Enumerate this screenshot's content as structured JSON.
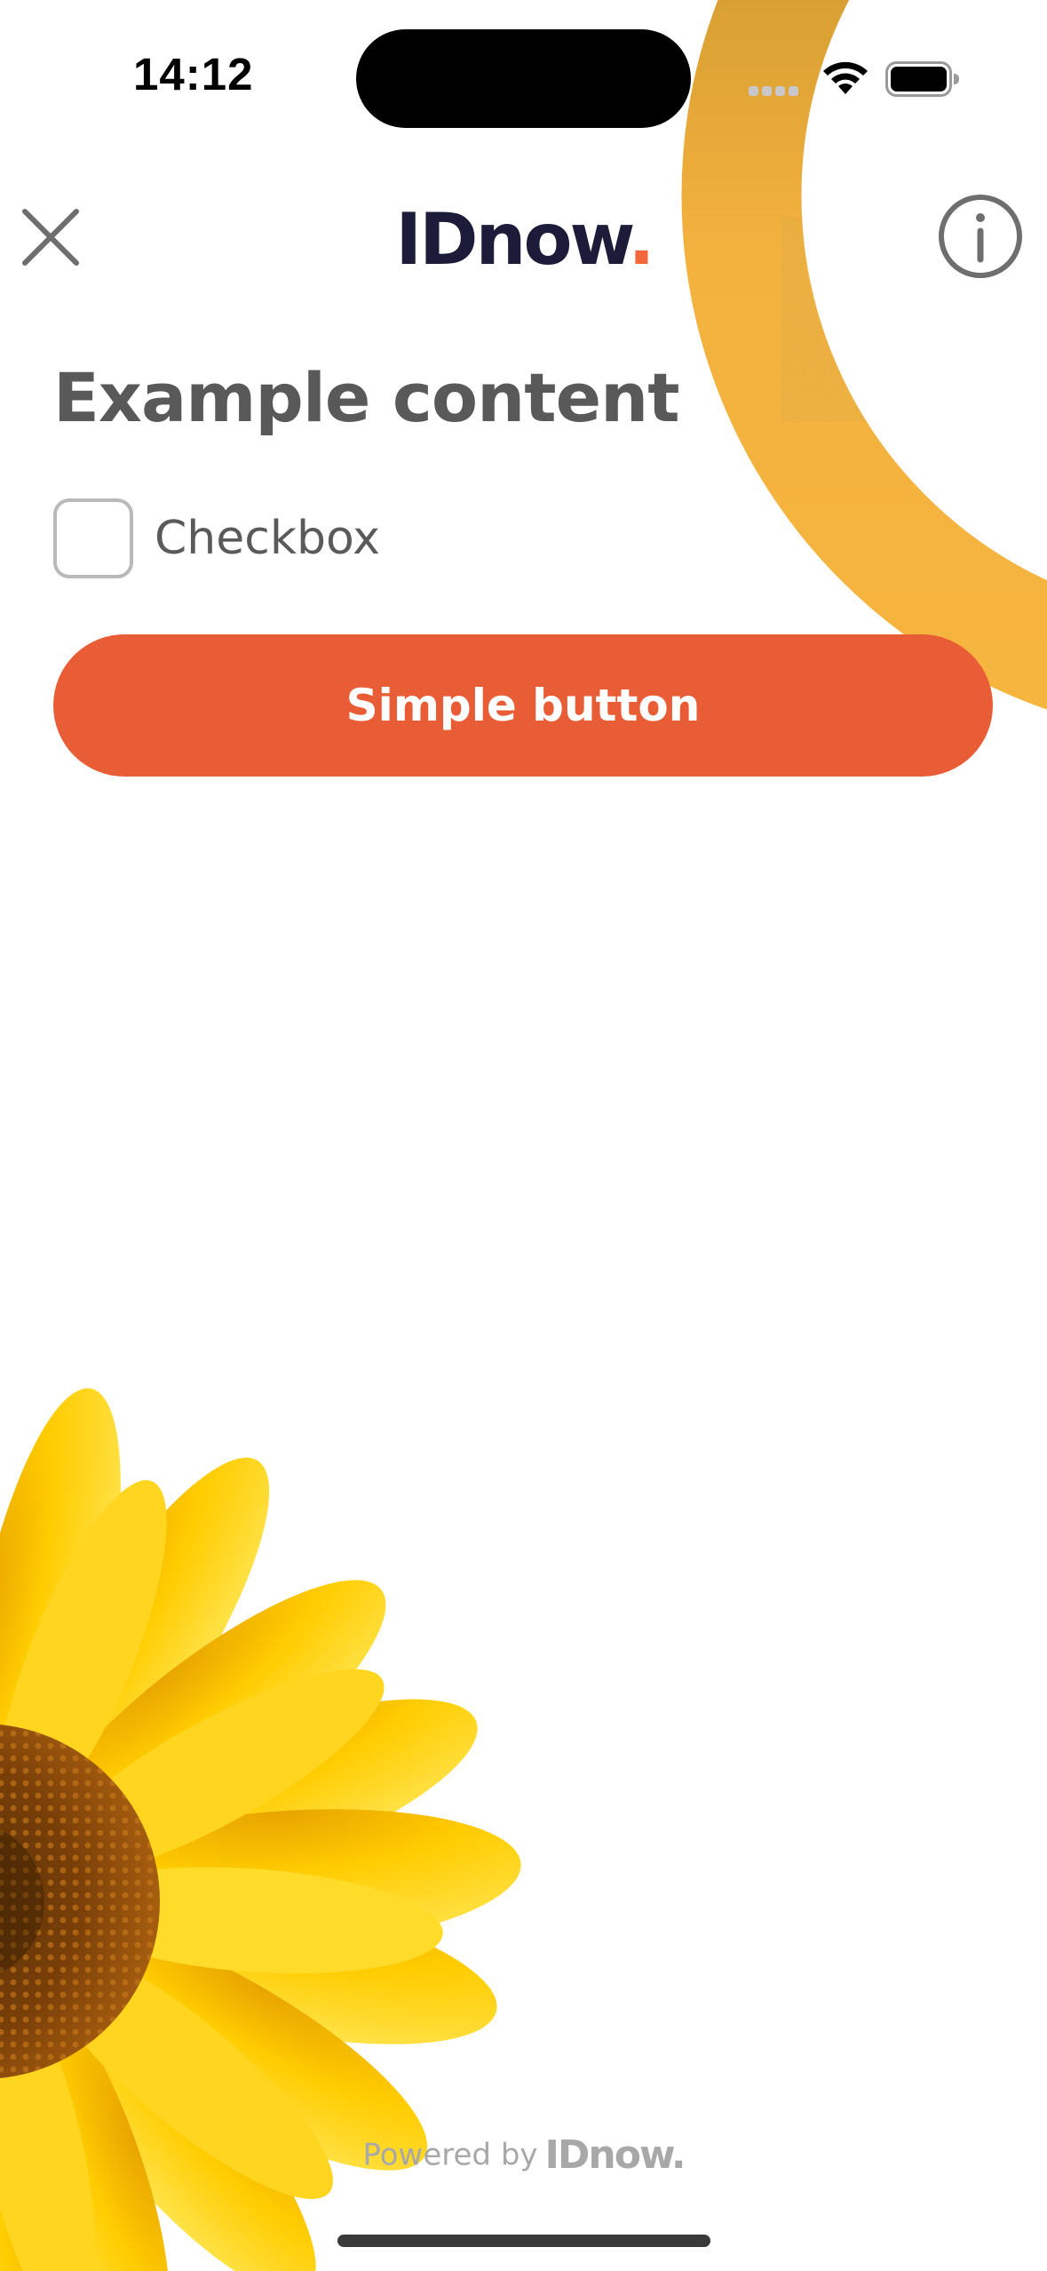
{
  "status_bar": {
    "time": "14:12",
    "icons": [
      "cellular-signal-icon",
      "wifi-icon",
      "battery-icon"
    ]
  },
  "header": {
    "close_icon": "close-icon",
    "logo_text": "IDnow",
    "logo_dot": ".",
    "info_icon": "info-icon"
  },
  "content": {
    "title": "Example content",
    "checkbox": {
      "label": "Checkbox",
      "checked": false
    },
    "button_label": "Simple button"
  },
  "footer": {
    "powered_by": "Powered by",
    "logo_text": "IDnow",
    "logo_dot": "."
  },
  "decorations": {
    "top_right": "orange-yellow-ring-art",
    "bottom_left": "sunflower-art"
  },
  "colors": {
    "accent": "#e85d35",
    "brand_dark": "#1c1c3a",
    "brand_dot": "#f2683c",
    "ring_orange": "#ff6a3d",
    "ring_yellow": "#f6b53f",
    "petal_yellow": "#ffcc00",
    "text_gray": "#595959"
  }
}
